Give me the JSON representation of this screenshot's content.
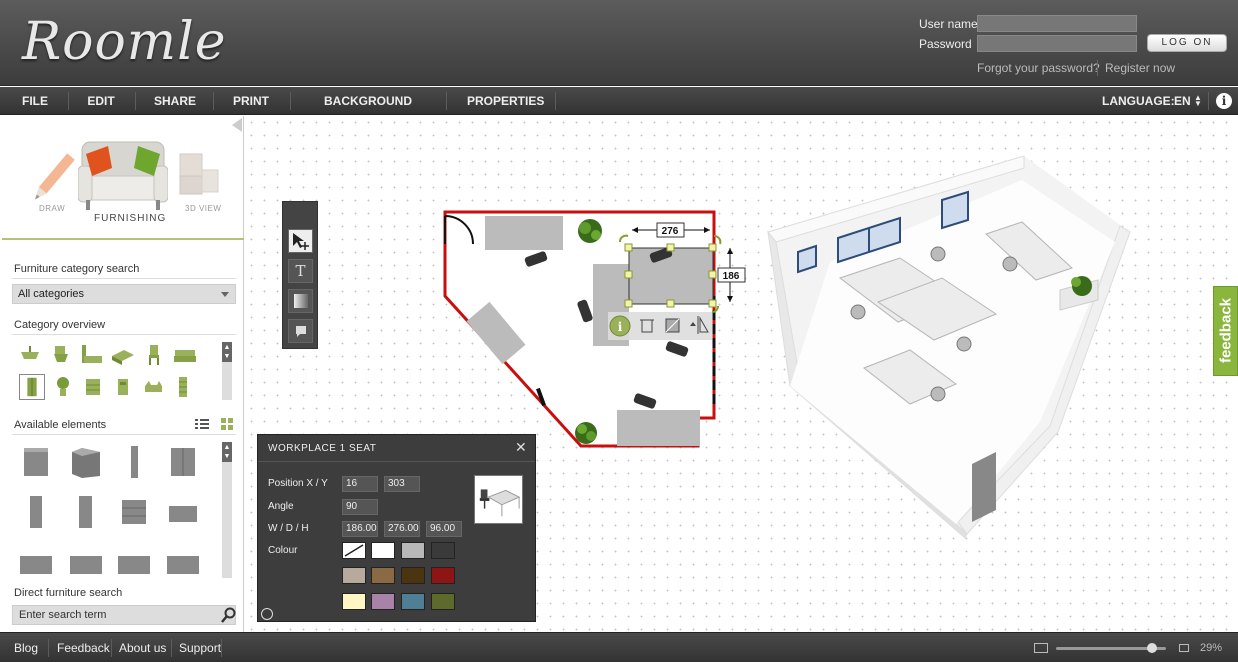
{
  "app": {
    "logo": "Roomle"
  },
  "login": {
    "username_label": "User name",
    "password_label": "Password",
    "username_value": "",
    "password_value": "",
    "login_button": "LOG ON",
    "forgot_link": "Forgot your password?",
    "register_link": "Register now"
  },
  "menu": {
    "items": [
      "FILE",
      "EDIT",
      "SHARE",
      "PRINT",
      "BACKGROUND IMAGE",
      "PROPERTIES"
    ],
    "language_label": "LANGUAGE:",
    "language_value": "EN",
    "info_icon": "i"
  },
  "modes": {
    "draw": "DRAW",
    "furnishing": "FURNISHING",
    "view3d": "3D VIEW"
  },
  "sidebar": {
    "category_search_label": "Furniture category search",
    "category_select_value": "All categories",
    "category_overview_label": "Category overview",
    "available_elements_label": "Available elements",
    "direct_search_label": "Direct furniture search",
    "search_placeholder": "Enter search term"
  },
  "plan": {
    "dimension_width": "276",
    "dimension_depth": "186"
  },
  "properties": {
    "title": "WORKPLACE 1 SEAT",
    "position_label": "Position X / Y",
    "position_x": "16",
    "position_y": "303",
    "angle_label": "Angle",
    "angle_value": "90",
    "size_label": "W / D / H",
    "width": "186.00",
    "depth": "276.00",
    "height": "96.00",
    "colour_label": "Colour",
    "swatches": [
      "none",
      "#ffffff",
      "#b8b8b8",
      "#3a3a3a",
      "#b5aa9c",
      "#8a6a45",
      "#4a3510",
      "#8e1515",
      "#fff6c4",
      "#a982a8",
      "#4f7f95",
      "#5e6a2c"
    ]
  },
  "feedback": {
    "label": "feedback"
  },
  "footer": {
    "links": [
      "Blog",
      "Feedback",
      "About us",
      "Support"
    ],
    "zoom": "29%"
  }
}
